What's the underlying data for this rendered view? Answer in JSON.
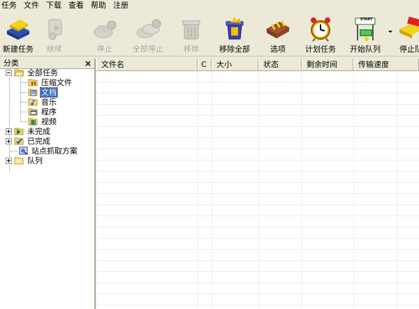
{
  "menu": [
    "任务",
    "文件",
    "下载",
    "查看",
    "帮助",
    "注册"
  ],
  "toolbar": {
    "buttons": [
      {
        "label": "新建任务",
        "icon": "new-task-icon",
        "enabled": true
      },
      {
        "label": "继续",
        "icon": "resume-icon",
        "enabled": false
      },
      {
        "label": "停止",
        "icon": "stop-icon",
        "enabled": false
      },
      {
        "label": "全部停止",
        "icon": "stop-all-icon",
        "enabled": false
      },
      {
        "label": "移除",
        "icon": "remove-icon",
        "enabled": false
      },
      {
        "label": "移除全部",
        "icon": "remove-all-icon",
        "enabled": true
      },
      {
        "label": "选项",
        "icon": "options-icon",
        "enabled": true
      },
      {
        "label": "计划任务",
        "icon": "scheduler-icon",
        "enabled": true
      },
      {
        "label": "开始队列",
        "icon": "start-queue-icon",
        "enabled": true,
        "start_text": "START"
      },
      {
        "label": "停止队",
        "icon": "stop-queue-icon",
        "enabled": true
      }
    ]
  },
  "sidebar": {
    "title": "分类",
    "close": "×",
    "tree": [
      {
        "label": "全部任务",
        "level": 0,
        "expander": "minus",
        "icon": "folder-open-icon"
      },
      {
        "label": "压缩文件",
        "level": 1,
        "icon": "archive-folder-icon"
      },
      {
        "label": "文档",
        "level": 1,
        "icon": "document-folder-icon",
        "selected": true
      },
      {
        "label": "音乐",
        "level": 1,
        "icon": "music-folder-icon"
      },
      {
        "label": "程序",
        "level": 1,
        "icon": "program-folder-icon"
      },
      {
        "label": "视频",
        "level": 1,
        "icon": "video-folder-icon"
      },
      {
        "label": "未完成",
        "level": 0,
        "expander": "plus",
        "icon": "unfinished-folder-icon"
      },
      {
        "label": "已完成",
        "level": 0,
        "expander": "plus",
        "icon": "finished-folder-icon"
      },
      {
        "label": "站点抓取方案",
        "level": 0,
        "icon": "site-grabber-icon"
      },
      {
        "label": "队列",
        "level": 0,
        "expander": "plus",
        "icon": "queue-folder-icon"
      }
    ]
  },
  "list": {
    "columns": [
      "文件名",
      "C",
      "大小",
      "状态",
      "剩余时间",
      "传输速度"
    ]
  },
  "colors": {
    "chrome": "#ECE9D8",
    "selection": "#316AC5"
  }
}
